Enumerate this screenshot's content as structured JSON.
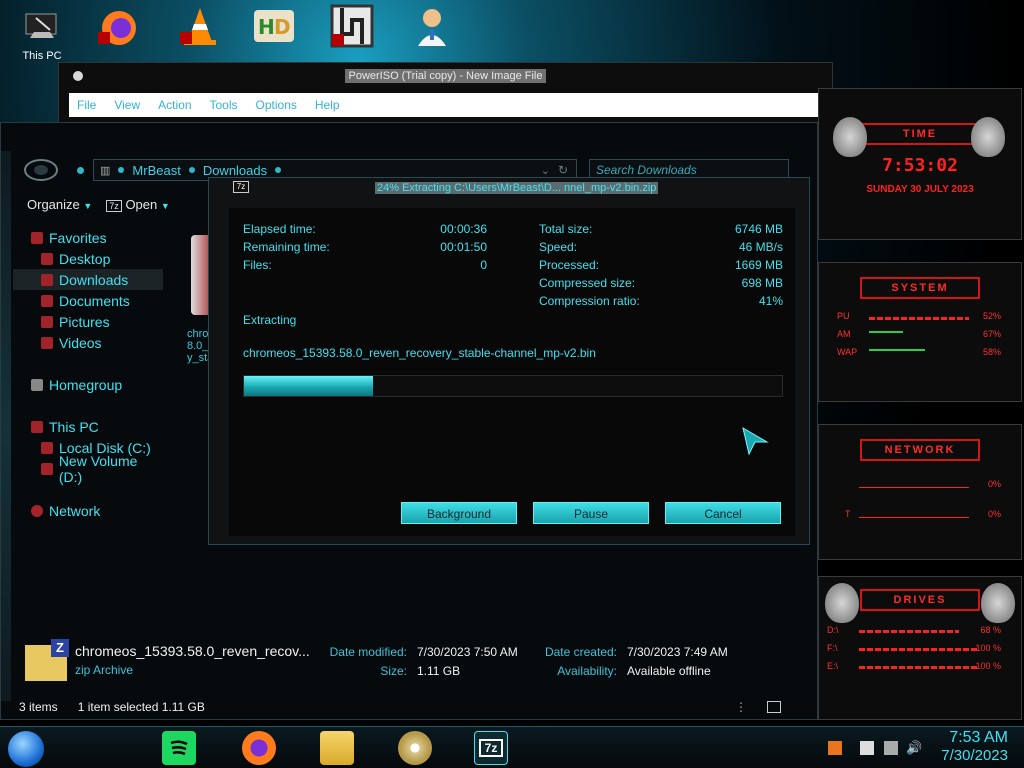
{
  "desktop": {
    "this_pc_label": "This PC"
  },
  "poweriso": {
    "title": "PowerISO (Trial copy) - New Image File",
    "menu": [
      "File",
      "View",
      "Action",
      "Tools",
      "Options",
      "Help"
    ]
  },
  "explorer": {
    "breadcrumb": [
      "MrBeast",
      "Downloads"
    ],
    "search_placeholder": "Search Downloads",
    "toolbar": {
      "organize": "Organize",
      "open": "Open"
    },
    "nav": {
      "favorites": "Favorites",
      "desktop": "Desktop",
      "downloads": "Downloads",
      "documents": "Documents",
      "pictures": "Pictures",
      "videos": "Videos",
      "homegroup": "Homegroup",
      "this_pc": "This PC",
      "local_disk": "Local Disk (C:)",
      "new_volume": "New Volume (D:)",
      "network": "Network"
    },
    "partial_file_text": [
      "chrom",
      "8.0_r",
      "y_sta"
    ],
    "details": {
      "name": "chromeos_15393.58.0_reven_recov...",
      "type": "zip Archive",
      "date_modified_label": "Date modified:",
      "date_modified": "7/30/2023 7:50 AM",
      "size_label": "Size:",
      "size": "1.11 GB",
      "date_created_label": "Date created:",
      "date_created": "7/30/2023 7:49 AM",
      "availability_label": "Availability:",
      "availability": "Available offline"
    },
    "status": {
      "items": "3 items",
      "selected": "1 item selected  1.11 GB"
    }
  },
  "dialog": {
    "title": "24% Extracting C:\\Users\\MrBeast\\D... nnel_mp-v2.bin.zip",
    "icon_text": "7z",
    "elapsed_label": "Elapsed time:",
    "elapsed": "00:00:36",
    "remaining_label": "Remaining time:",
    "remaining": "00:01:50",
    "files_label": "Files:",
    "files": "0",
    "total_size_label": "Total size:",
    "total_size": "6746 MB",
    "speed_label": "Speed:",
    "speed": "46 MB/s",
    "processed_label": "Processed:",
    "processed": "1669 MB",
    "compressed_label": "Compressed size:",
    "compressed": "698 MB",
    "ratio_label": "Compression ratio:",
    "ratio": "41%",
    "operation": "Extracting",
    "current_file": "chromeos_15393.58.0_reven_recovery_stable-channel_mp-v2.bin",
    "progress": 0.24,
    "buttons": {
      "background": "Background",
      "pause": "Pause",
      "cancel": "Cancel"
    }
  },
  "widgets": {
    "time": {
      "header": "TIME",
      "clock": "7:53:02",
      "date": "SUNDAY 30 JULY 2023"
    },
    "system": {
      "header": "SYSTEM",
      "rows": [
        {
          "label": "PU",
          "value": "52%"
        },
        {
          "label": "AM",
          "value": "67%"
        },
        {
          "label": "WAP",
          "value": "58%"
        }
      ]
    },
    "network": {
      "header": "NETWORK",
      "rows": [
        {
          "value": "0%"
        },
        {
          "label": "T",
          "value": "0%"
        }
      ]
    },
    "drives": {
      "header": "DRIVES",
      "rows": [
        {
          "label": "D:\\",
          "value": "68 %"
        },
        {
          "label": "F:\\",
          "value": "100 %"
        },
        {
          "label": "E:\\",
          "value": "100 %"
        }
      ]
    }
  },
  "taskbar": {
    "time": "7:53 AM",
    "date": "7/30/2023",
    "active_app_label": "7z"
  },
  "colors": {
    "accent": "#3fe0f0",
    "alert": "#ff2020",
    "button": "#22b8c2"
  }
}
